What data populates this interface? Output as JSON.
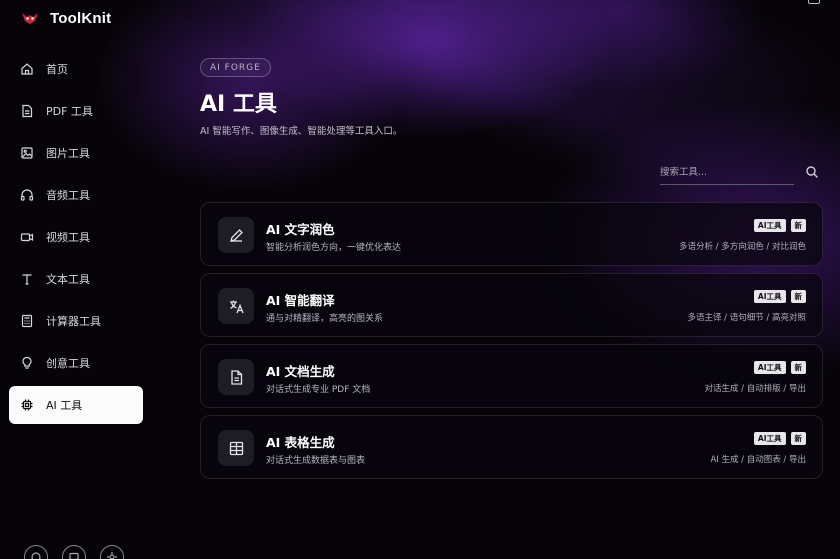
{
  "app": {
    "name": "ToolKnit"
  },
  "sidebar": {
    "items": [
      {
        "label": "首页",
        "icon": "home-icon"
      },
      {
        "label": "PDF 工具",
        "icon": "pdf-file-icon"
      },
      {
        "label": "图片工具",
        "icon": "image-icon"
      },
      {
        "label": "音频工具",
        "icon": "headphones-icon"
      },
      {
        "label": "视频工具",
        "icon": "video-camera-icon"
      },
      {
        "label": "文本工具",
        "icon": "text-icon"
      },
      {
        "label": "计算器工具",
        "icon": "calculator-icon"
      },
      {
        "label": "创意工具",
        "icon": "lightbulb-icon"
      },
      {
        "label": "AI 工具",
        "icon": "chip-icon",
        "active": true
      }
    ]
  },
  "header": {
    "badge": "AI FORGE",
    "title": "AI 工具",
    "subtitle": "AI 智能写作、图像生成、智能处理等工具入口。"
  },
  "search": {
    "placeholder": "搜索工具..."
  },
  "tools": [
    {
      "title": "AI 文字润色",
      "desc": "智能分析润色方向，一键优化表达",
      "tag": "AI工具",
      "new": "新",
      "meta": "多语分析 / 多方向润色 / 对比润色",
      "icon": "pen-icon"
    },
    {
      "title": "AI 智能翻译",
      "desc": "通与对精翻译，高亮的图关系",
      "tag": "AI工具",
      "new": "新",
      "meta": "多语主译 / 语句细节 / 高亮对照",
      "icon": "translate-icon"
    },
    {
      "title": "AI 文档生成",
      "desc": "对话式生成专业 PDF 文档",
      "tag": "AI工具",
      "new": "新",
      "meta": "对话生成 / 自动排版 / 导出",
      "icon": "document-icon"
    },
    {
      "title": "AI 表格生成",
      "desc": "对话式生成数据表与图表",
      "tag": "AI工具",
      "new": "新",
      "meta": "AI 生成 / 自动图表 / 导出",
      "icon": "table-icon"
    }
  ],
  "colors": {
    "accent": "#7a2fd0",
    "background": "#060408",
    "active_bg": "#fbfbfc"
  }
}
